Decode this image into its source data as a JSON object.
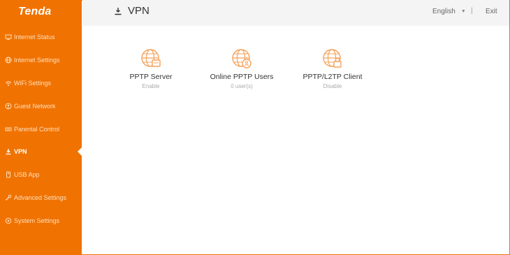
{
  "brand": {
    "logo_text": "Tenda",
    "accent_color": "#f07200"
  },
  "sidebar": {
    "items": [
      {
        "label": "Internet Status",
        "icon": "internet-status-icon",
        "active": false
      },
      {
        "label": "Internet Settings",
        "icon": "globe-icon",
        "active": false
      },
      {
        "label": "WiFi Settings",
        "icon": "wifi-icon",
        "active": false
      },
      {
        "label": "Guest Network",
        "icon": "guest-network-icon",
        "active": false
      },
      {
        "label": "Parental Control",
        "icon": "parental-control-icon",
        "active": false
      },
      {
        "label": "VPN",
        "icon": "vpn-icon",
        "active": true
      },
      {
        "label": "USB App",
        "icon": "usb-icon",
        "active": false
      },
      {
        "label": "Advanced Settings",
        "icon": "wrench-icon",
        "active": false
      },
      {
        "label": "System Settings",
        "icon": "system-settings-icon",
        "active": false
      }
    ]
  },
  "header": {
    "title": "VPN",
    "title_icon": "vpn-icon",
    "language": "English",
    "separator": "|",
    "exit_label": "Exit"
  },
  "main": {
    "cards": [
      {
        "title": "PPTP Server",
        "status": "Enable",
        "icon": "globe-server-icon"
      },
      {
        "title": "Online PPTP Users",
        "status": "0 user(s)",
        "icon": "globe-user-icon"
      },
      {
        "title": "PPTP/L2TP Client",
        "status": "Disable",
        "icon": "globe-lock-icon"
      }
    ]
  }
}
